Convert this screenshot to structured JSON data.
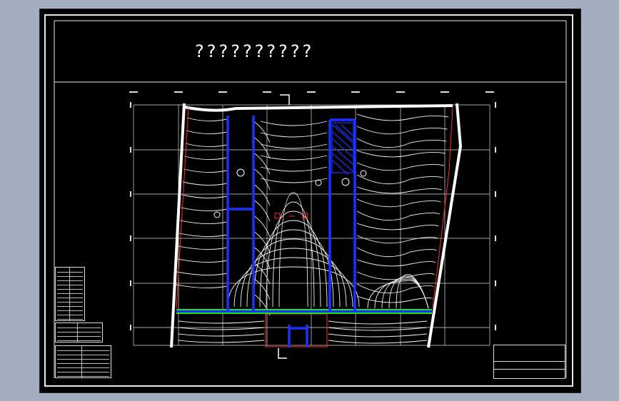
{
  "drawing": {
    "title": "??????????",
    "colors": {
      "background": "#000000",
      "frame": "#ffffff",
      "contour": "#ffffff",
      "wall": "#1f2fff",
      "green_line": "#19e619",
      "red_line": "#ff2a2a",
      "surround": "#a3adc0"
    },
    "icons": [
      "elevation-marker-icon",
      "north-arrow-icon"
    ]
  }
}
